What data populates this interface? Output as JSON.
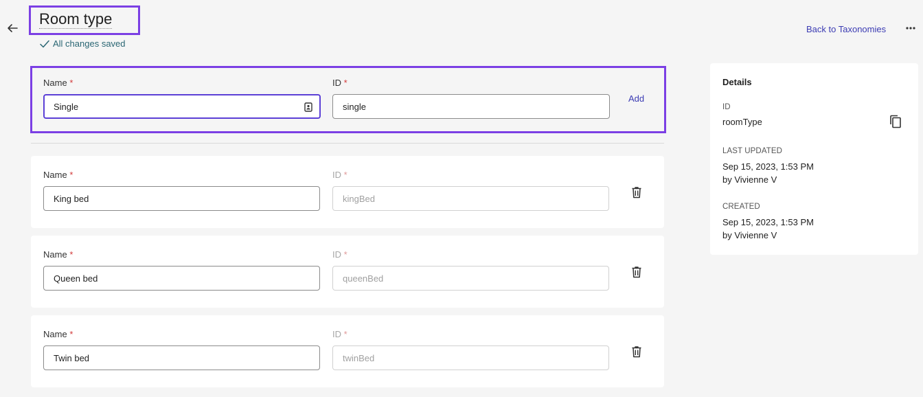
{
  "header": {
    "title": "Room type",
    "save_status": "All changes saved",
    "back_link": "Back to Taxonomies",
    "icons": {
      "back": "arrow-left-icon",
      "more": "more-horizontal-icon",
      "saved": "check-icon"
    }
  },
  "new_term": {
    "name_label": "Name",
    "id_label": "ID",
    "required_mark": "*",
    "name_value": "Single",
    "id_value": "single",
    "add_label": "Add"
  },
  "terms": [
    {
      "name_label": "Name",
      "id_label": "ID",
      "required_mark": "*",
      "name_value": "King bed",
      "id_value": "kingBed"
    },
    {
      "name_label": "Name",
      "id_label": "ID",
      "required_mark": "*",
      "name_value": "Queen bed",
      "id_value": "queenBed"
    },
    {
      "name_label": "Name",
      "id_label": "ID",
      "required_mark": "*",
      "name_value": "Twin bed",
      "id_value": "twinBed"
    }
  ],
  "details": {
    "title": "Details",
    "id_label": "ID",
    "id_value": "roomType",
    "last_updated_label": "LAST UPDATED",
    "last_updated_date": "Sep 15, 2023, 1:53 PM",
    "last_updated_by": "by Vivienne V",
    "created_label": "CREATED",
    "created_date": "Sep 15, 2023, 1:53 PM",
    "created_by": "by Vivienne V"
  },
  "colors": {
    "accent": "#7b3fe4",
    "link": "#3b3bb3",
    "required": "#d23b3b",
    "saved": "#2a6673"
  }
}
